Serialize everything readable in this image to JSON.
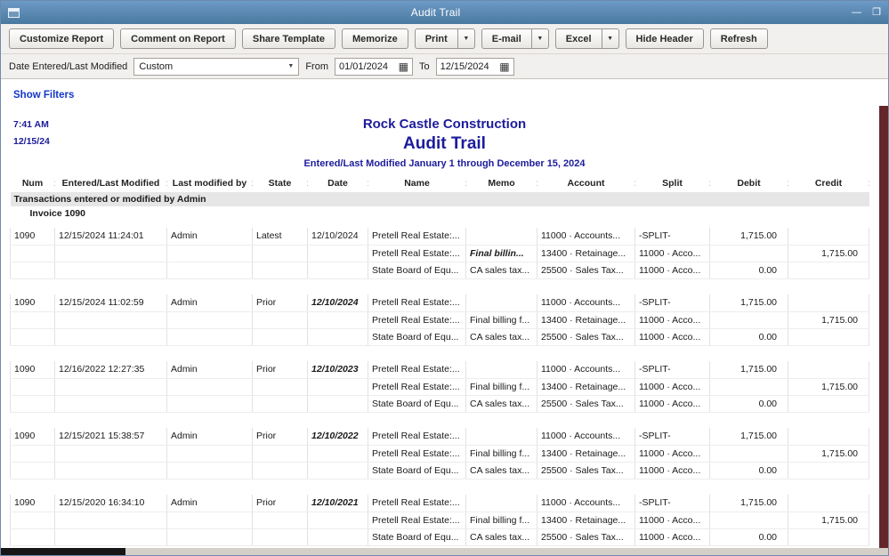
{
  "window": {
    "title": "Audit Trail"
  },
  "icons": {
    "dropdown_arrow": "▼",
    "calendar": "▦",
    "minimize": "—",
    "maximize": "❐"
  },
  "toolbar": {
    "customize": "Customize Report",
    "comment": "Comment on Report",
    "share": "Share Template",
    "memorize": "Memorize",
    "print": "Print",
    "email": "E-mail",
    "excel": "Excel",
    "hide_header": "Hide Header",
    "refresh": "Refresh"
  },
  "filters": {
    "label": "Date Entered/Last Modified",
    "range_value": "Custom",
    "from_label": "From",
    "from_value": "01/01/2024",
    "to_label": "To",
    "to_value": "12/15/2024",
    "show_filters": "Show Filters"
  },
  "report": {
    "time": "7:41 AM",
    "date": "12/15/24",
    "company": "Rock Castle Construction",
    "title": "Audit Trail",
    "subtitle": "Entered/Last Modified January 1 through December 15, 2024",
    "columns": [
      "Num",
      "Entered/Last Modified",
      "Last modified by",
      "State",
      "Date",
      "Name",
      "Memo",
      "Account",
      "Split",
      "Debit",
      "Credit"
    ],
    "section_header": "Transactions entered or modified by Admin",
    "group_header": "Invoice 1090",
    "groups": [
      [
        {
          "num": "1090",
          "entered": "12/15/2024 11:24:01",
          "by": "Admin",
          "state": "Latest",
          "date": "12/10/2024",
          "date_em": false,
          "name": "Pretell Real Estate:...",
          "memo": "",
          "memo_em": false,
          "account": "11000 · Accounts...",
          "split": "-SPLIT-",
          "debit": "1,715.00",
          "credit": ""
        },
        {
          "num": "",
          "entered": "",
          "by": "",
          "state": "",
          "date": "",
          "date_em": false,
          "name": "Pretell Real Estate:...",
          "memo": "Final billin...",
          "memo_em": true,
          "account": "13400 · Retainage...",
          "split": "11000 · Acco...",
          "debit": "",
          "credit": "1,715.00"
        },
        {
          "num": "",
          "entered": "",
          "by": "",
          "state": "",
          "date": "",
          "date_em": false,
          "name": "State Board of Equ...",
          "memo": "CA sales tax...",
          "memo_em": false,
          "account": "25500 · Sales Tax...",
          "split": "11000 · Acco...",
          "debit": "0.00",
          "credit": ""
        }
      ],
      [
        {
          "num": "1090",
          "entered": "12/15/2024 11:02:59",
          "by": "Admin",
          "state": "Prior",
          "date": "12/10/2024",
          "date_em": true,
          "name": "Pretell Real Estate:...",
          "memo": "",
          "memo_em": false,
          "account": "11000 · Accounts...",
          "split": "-SPLIT-",
          "debit": "1,715.00",
          "credit": ""
        },
        {
          "num": "",
          "entered": "",
          "by": "",
          "state": "",
          "date": "",
          "date_em": false,
          "name": "Pretell Real Estate:...",
          "memo": "Final billing f...",
          "memo_em": false,
          "account": "13400 · Retainage...",
          "split": "11000 · Acco...",
          "debit": "",
          "credit": "1,715.00"
        },
        {
          "num": "",
          "entered": "",
          "by": "",
          "state": "",
          "date": "",
          "date_em": false,
          "name": "State Board of Equ...",
          "memo": "CA sales tax...",
          "memo_em": false,
          "account": "25500 · Sales Tax...",
          "split": "11000 · Acco...",
          "debit": "0.00",
          "credit": ""
        }
      ],
      [
        {
          "num": "1090",
          "entered": "12/16/2022 12:27:35",
          "by": "Admin",
          "state": "Prior",
          "date": "12/10/2023",
          "date_em": true,
          "name": "Pretell Real Estate:...",
          "memo": "",
          "memo_em": false,
          "account": "11000 · Accounts...",
          "split": "-SPLIT-",
          "debit": "1,715.00",
          "credit": ""
        },
        {
          "num": "",
          "entered": "",
          "by": "",
          "state": "",
          "date": "",
          "date_em": false,
          "name": "Pretell Real Estate:...",
          "memo": "Final billing f...",
          "memo_em": false,
          "account": "13400 · Retainage...",
          "split": "11000 · Acco...",
          "debit": "",
          "credit": "1,715.00"
        },
        {
          "num": "",
          "entered": "",
          "by": "",
          "state": "",
          "date": "",
          "date_em": false,
          "name": "State Board of Equ...",
          "memo": "CA sales tax...",
          "memo_em": false,
          "account": "25500 · Sales Tax...",
          "split": "11000 · Acco...",
          "debit": "0.00",
          "credit": ""
        }
      ],
      [
        {
          "num": "1090",
          "entered": "12/15/2021 15:38:57",
          "by": "Admin",
          "state": "Prior",
          "date": "12/10/2022",
          "date_em": true,
          "name": "Pretell Real Estate:...",
          "memo": "",
          "memo_em": false,
          "account": "11000 · Accounts...",
          "split": "-SPLIT-",
          "debit": "1,715.00",
          "credit": ""
        },
        {
          "num": "",
          "entered": "",
          "by": "",
          "state": "",
          "date": "",
          "date_em": false,
          "name": "Pretell Real Estate:...",
          "memo": "Final billing f...",
          "memo_em": false,
          "account": "13400 · Retainage...",
          "split": "11000 · Acco...",
          "debit": "",
          "credit": "1,715.00"
        },
        {
          "num": "",
          "entered": "",
          "by": "",
          "state": "",
          "date": "",
          "date_em": false,
          "name": "State Board of Equ...",
          "memo": "CA sales tax...",
          "memo_em": false,
          "account": "25500 · Sales Tax...",
          "split": "11000 · Acco...",
          "debit": "0.00",
          "credit": ""
        }
      ],
      [
        {
          "num": "1090",
          "entered": "12/15/2020 16:34:10",
          "by": "Admin",
          "state": "Prior",
          "date": "12/10/2021",
          "date_em": true,
          "name": "Pretell Real Estate:...",
          "memo": "",
          "memo_em": false,
          "account": "11000 · Accounts...",
          "split": "-SPLIT-",
          "debit": "1,715.00",
          "credit": ""
        },
        {
          "num": "",
          "entered": "",
          "by": "",
          "state": "",
          "date": "",
          "date_em": false,
          "name": "Pretell Real Estate:...",
          "memo": "Final billing f...",
          "memo_em": false,
          "account": "13400 · Retainage...",
          "split": "11000 · Acco...",
          "debit": "",
          "credit": "1,715.00"
        },
        {
          "num": "",
          "entered": "",
          "by": "",
          "state": "",
          "date": "",
          "date_em": false,
          "name": "State Board of Equ...",
          "memo": "CA sales tax...",
          "memo_em": false,
          "account": "25500 · Sales Tax...",
          "split": "11000 · Acco...",
          "debit": "0.00",
          "credit": ""
        }
      ]
    ]
  }
}
